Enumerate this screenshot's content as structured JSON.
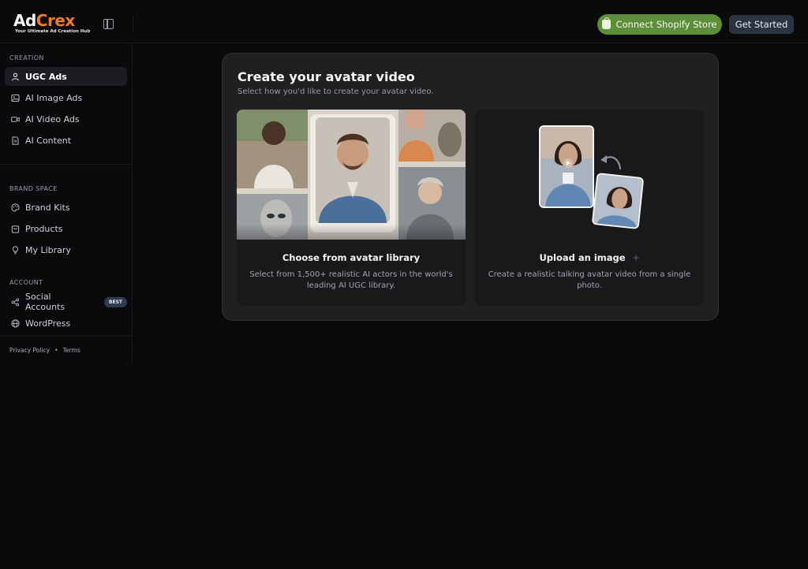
{
  "header": {
    "logo": {
      "brand_part1": "Ad",
      "brand_part2": "Crex",
      "tagline": "Your Ultimate Ad Creation Hub"
    },
    "shopify_button": "Connect Shopify Store",
    "get_started_button": "Get Started",
    "colors": {
      "brand_orange": "#f07b2a",
      "shopify_green": "#5d8f3a"
    }
  },
  "sidebar": {
    "sections": [
      {
        "label": "CREATION",
        "items": [
          {
            "label": "UGC Ads",
            "icon": "user-icon",
            "active": true
          },
          {
            "label": "AI Image Ads",
            "icon": "image-icon"
          },
          {
            "label": "AI Video Ads",
            "icon": "video-icon"
          },
          {
            "label": "AI Content",
            "icon": "document-icon"
          }
        ]
      },
      {
        "label": "BRAND SPACE",
        "items": [
          {
            "label": "Brand Kits",
            "icon": "palette-icon"
          },
          {
            "label": "Products",
            "icon": "shopping-bag-icon"
          },
          {
            "label": "My Library",
            "icon": "lightbulb-icon"
          }
        ]
      },
      {
        "label": "ACCOUNT",
        "items": [
          {
            "label": "Social Accounts",
            "icon": "share-icon",
            "badge": "BEST"
          },
          {
            "label": "WordPress",
            "icon": "globe-icon"
          }
        ]
      }
    ],
    "footer": {
      "privacy": "Privacy Policy",
      "separator": "•",
      "terms": "Terms"
    }
  },
  "main": {
    "title": "Create your avatar video",
    "subtitle": "Select how you'd like to create your avatar video.",
    "options": [
      {
        "title": "Choose from avatar library",
        "description": "Select from 1,500+ realistic AI actors in the world's leading AI UGC library."
      },
      {
        "title": "Upload an image",
        "description": "Create a realistic talking avatar video from a single photo."
      }
    ]
  }
}
